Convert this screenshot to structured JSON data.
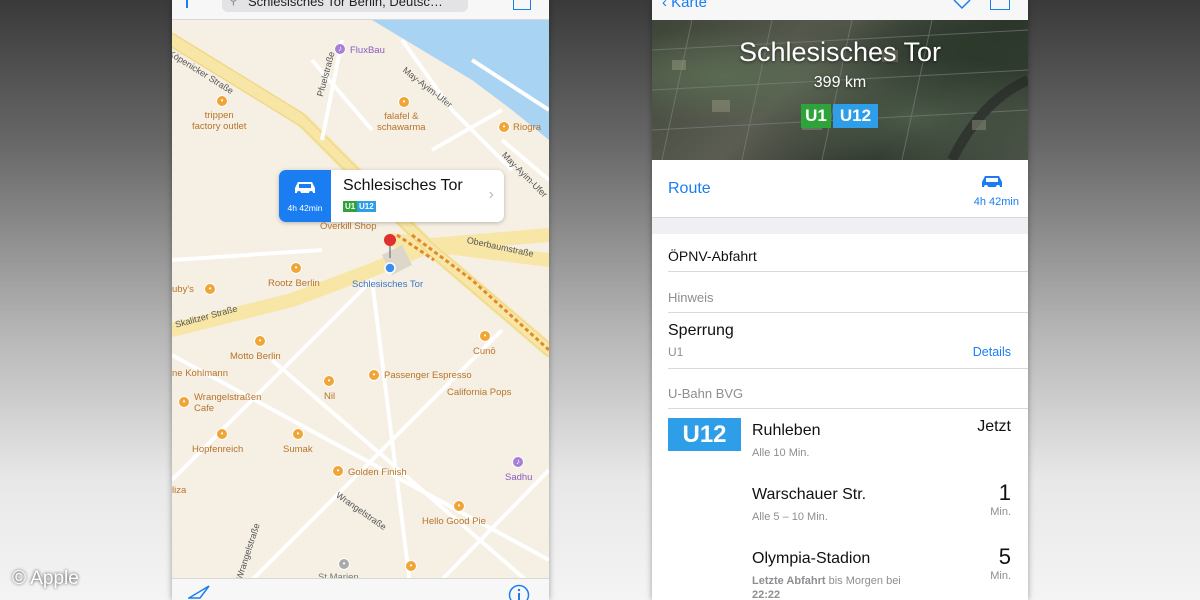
{
  "copyright": "© Apple",
  "map": {
    "search_text": "Schlesisches Tor Berlin, Deutsc…",
    "roads": {
      "kopenicker": "Köpenicker Straße",
      "pfuelstrasse": "Pfuelstraße",
      "may_ayim_ufer": "May-Ayim-Ufer",
      "may_ayim_ufer_2": "May-Ayim-Ufer",
      "oberbaumstrasse": "Oberbaumstraße",
      "skalitzer": "Skalitzer Straße",
      "wrangelstrasse": "Wrangelstraße",
      "wrangelstrasse_2": "Wrangelstraße",
      "wrangelstrasse_3": "Wrangelstraße"
    },
    "pois": {
      "fluxbau": "FluxBau",
      "trippen": "trippen\nfactory outlet",
      "falafel": "falafel &\nschawarma",
      "riogra": "Riogra",
      "overkill": "Overkill Shop",
      "schlesisches_tor": "Schlesisches Tor",
      "rootz": "Rootz Berlin",
      "rubys": "uby's",
      "motto": "Motto Berlin",
      "cuno": "Cunō",
      "kohlmann": "ne Kohlmann",
      "passenger": "Passenger Espresso",
      "nil": "Nil",
      "california": "California Pops",
      "cafe": "Wrangelstraßen\nCafe",
      "hopfenreich": "Hopfenreich",
      "sumak": "Sumak",
      "golden": "Golden Finish",
      "sadhu": "Sadhu",
      "liza": "liza",
      "hellogood": "Hello Good Pie",
      "stmarion": "St Marien"
    },
    "callout": {
      "title": "Schlesisches Tor",
      "eta": "4h 42min",
      "badge_u1": "U1",
      "badge_u12": "U12",
      "icon": "car-icon"
    }
  },
  "details": {
    "back_label": "Karte",
    "hero_title": "Schlesisches Tor",
    "hero_distance": "399 km",
    "badge_u1": "U1",
    "badge_u12": "U12",
    "colors": {
      "u1": "#2ea33a",
      "u12": "#2f9ee8",
      "accent": "#1a7ef2"
    },
    "route_label": "Route",
    "route_eta": "4h 42min",
    "section_opnv": "ÖPNV-Abfahrt",
    "section_hinweis": "Hinweis",
    "sperrung_title": "Sperrung",
    "sperrung_line": "U1",
    "details_link": "Details",
    "section_ubahn": "U-Bahn BVG",
    "line_badge": "U12",
    "departures": [
      {
        "destination": "Ruhleben",
        "frequency": "Alle 10 Min.",
        "time": "Jetzt",
        "unit": ""
      },
      {
        "destination": "Warschauer Str.",
        "frequency": "Alle 5 – 10 Min.",
        "time": "1",
        "unit": "Min."
      },
      {
        "destination": "Olympia-Stadion",
        "frequency_bold": "Letzte Abfahrt",
        "frequency": " bis Morgen bei",
        "frequency_2": "22:22",
        "time": "5",
        "unit": "Min."
      }
    ]
  }
}
